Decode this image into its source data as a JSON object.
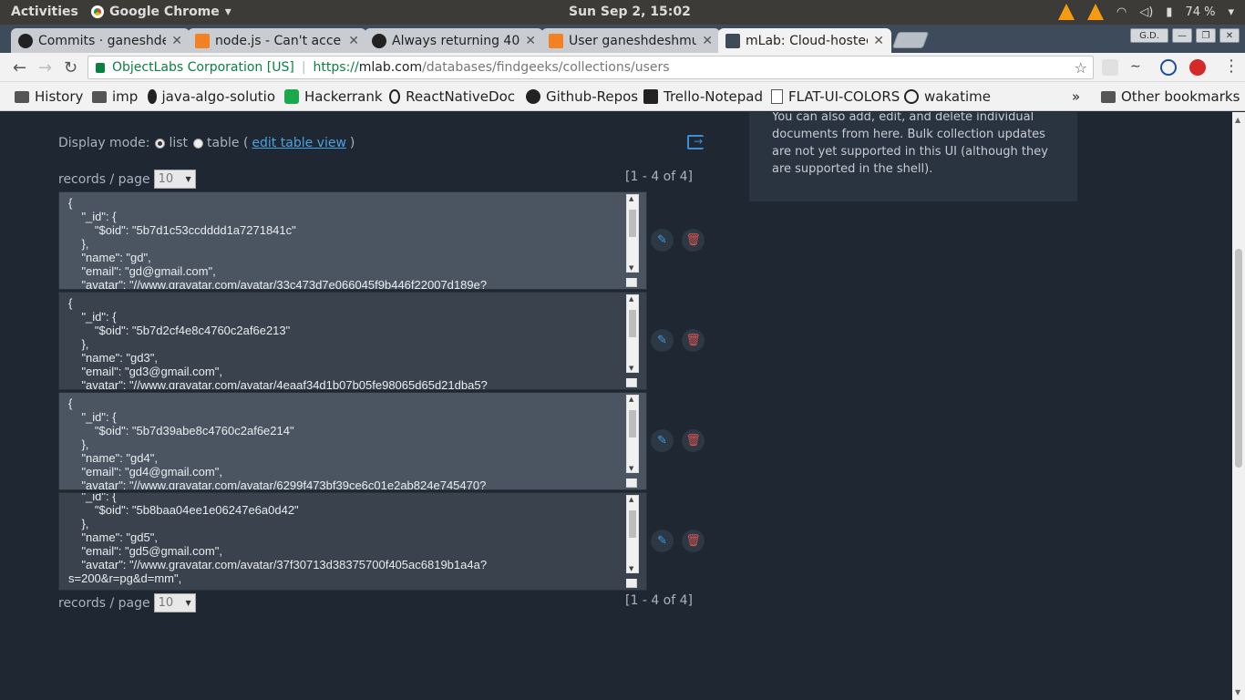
{
  "os": {
    "activities": "Activities",
    "app_name": "Google Chrome",
    "clock": "Sun Sep  2, 15:02",
    "battery": "74 %"
  },
  "tabs": [
    {
      "label": "Commits · ganeshde",
      "icon": "github-icon"
    },
    {
      "label": "node.js - Can't acce",
      "icon": "stackoverflow-icon"
    },
    {
      "label": "Always returning 40",
      "icon": "github-icon"
    },
    {
      "label": "User ganeshdeshmu",
      "icon": "stackoverflow-icon"
    },
    {
      "label": "mLab: Cloud-hostec",
      "icon": "mlab-icon"
    }
  ],
  "window": {
    "profile": "G.D."
  },
  "omnibox": {
    "secure_label": "ObjectLabs Corporation [US]",
    "url_proto": "https://",
    "url_host": "mlab.com",
    "url_path": "/databases/findgeeks/collections/users"
  },
  "bookmarks": [
    {
      "label": "History",
      "icon": "folder-icon"
    },
    {
      "label": "imp",
      "icon": "folder-icon"
    },
    {
      "label": "java-algo-solutio",
      "icon": "github-icon"
    },
    {
      "label": "Hackerrank",
      "icon": "hackerrank-icon"
    },
    {
      "label": "ReactNativeDoc",
      "icon": "react-icon"
    },
    {
      "label": "Github-Repos",
      "icon": "github-icon"
    },
    {
      "label": "Trello-Notepad",
      "icon": "trello-icon"
    },
    {
      "label": "FLAT-UI-COLORS",
      "icon": "document-icon"
    },
    {
      "label": "wakatime",
      "icon": "wakatime-icon"
    }
  ],
  "bookmarks_more": "»",
  "other_bookmarks": "Other bookmarks",
  "side_panel": {
    "text": "You can also add, edit, and delete individual documents from here. Bulk collection updates are not yet supported in this UI (although they are supported in the shell)."
  },
  "display_mode": {
    "label": "Display mode:",
    "list": "list",
    "table": "table (",
    "edit_table_view": "edit table view",
    "close_paren": ")"
  },
  "pager": {
    "label": "records / page",
    "value": "10",
    "range": "[1 - 4 of 4]"
  },
  "records": [
    {
      "text": "{\n    \"_id\": {\n        \"$oid\": \"5b7d1c53ccdddd1a7271841c\"\n    },\n    \"name\": \"gd\",\n    \"email\": \"gd@gmail.com\",\n    \"avatar\": \"//www.gravatar.com/avatar/33c473d7e066045f9b446f22007d189e?"
    },
    {
      "text": "{\n    \"_id\": {\n        \"$oid\": \"5b7d2cf4e8c4760c2af6e213\"\n    },\n    \"name\": \"gd3\",\n    \"email\": \"gd3@gmail.com\",\n    \"avatar\": \"//www.gravatar.com/avatar/4eaaf34d1b07b05fe98065d65d21dba5?"
    },
    {
      "text": "{\n    \"_id\": {\n        \"$oid\": \"5b7d39abe8c4760c2af6e214\"\n    },\n    \"name\": \"gd4\",\n    \"email\": \"gd4@gmail.com\",\n    \"avatar\": \"//www.gravatar.com/avatar/6299f473bf39ce6c01e2ab824e745470?"
    },
    {
      "text": "    \"_id\": {\n        \"$oid\": \"5b8baa04ee1e06247e6a0d42\"\n    },\n    \"name\": \"gd5\",\n    \"email\": \"gd5@gmail.com\",\n    \"avatar\": \"//www.gravatar.com/avatar/37f30713d38375700f405ac6819b1a4a?\ns=200&r=pg&d=mm\","
    }
  ],
  "colors": {
    "page_bg": "#1f2733",
    "record_bg": "#4a5561",
    "record_alt_bg": "#39424d",
    "link": "#4aa3df",
    "edit": "#3f9be0",
    "delete": "#d9534f"
  }
}
